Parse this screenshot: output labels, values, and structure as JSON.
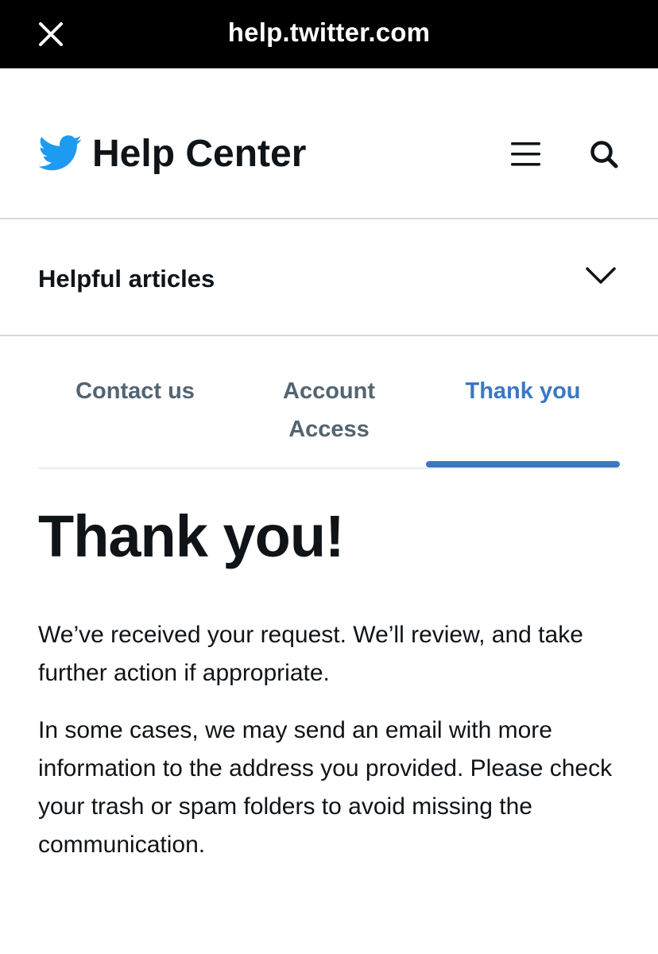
{
  "browser": {
    "url": "help.twitter.com",
    "close_icon": "close-icon"
  },
  "header": {
    "logo_icon": "twitter-bird-icon",
    "title": "Help Center",
    "menu_icon": "hamburger-menu-icon",
    "search_icon": "search-icon",
    "brand_color": "#1d9bf0"
  },
  "helpful": {
    "label": "Helpful articles",
    "chevron_icon": "chevron-down-icon"
  },
  "tabs": [
    {
      "line1": "Contact us",
      "line2": "",
      "active": false
    },
    {
      "line1": "Account",
      "line2": "Access",
      "active": false
    },
    {
      "line1": "Thank you",
      "line2": "",
      "active": true
    }
  ],
  "tab_active_color": "#3b78c2",
  "main": {
    "title": "Thank you!",
    "paragraph1": "We’ve received your request. We’ll review, and take further action if appropriate.",
    "paragraph2": "In some cases, we may send an email with more information to the address you provided. Please check your trash or spam folders to avoid missing the communication."
  }
}
